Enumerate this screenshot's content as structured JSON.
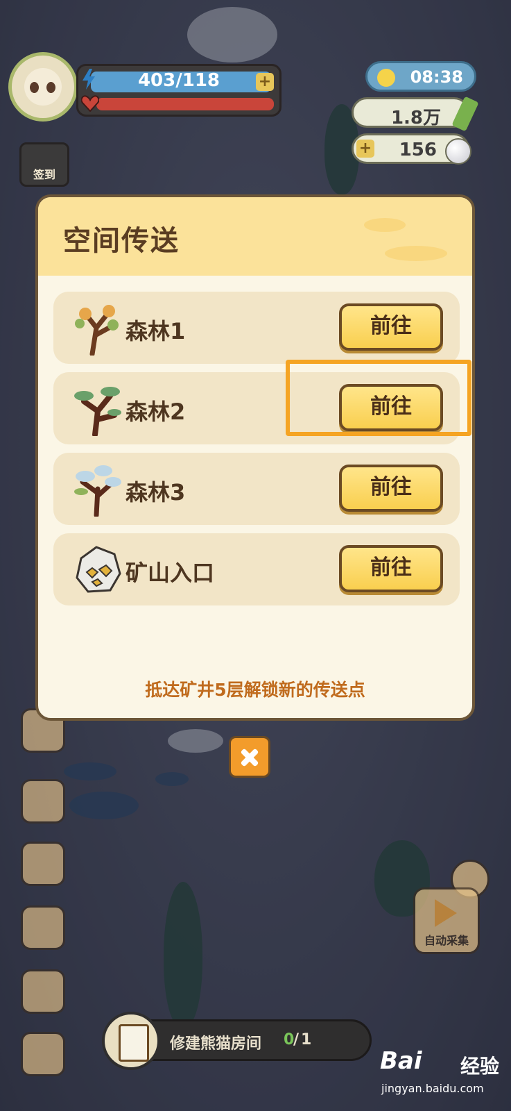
{
  "hud": {
    "energy": "403/118",
    "energy_plus": "+",
    "clock": "08:38",
    "currency_bamboo": "1.8万",
    "pearl_plus": "+",
    "pearls": "156",
    "signin_label": "签到"
  },
  "dialog": {
    "title": "空间传送",
    "destinations": [
      {
        "name": "森林1",
        "button": "前往",
        "icon": "forest-tree-icon"
      },
      {
        "name": "森林2",
        "button": "前往",
        "icon": "forest-tree-icon"
      },
      {
        "name": "森林3",
        "button": "前往",
        "icon": "mushroom-tree-icon"
      },
      {
        "name": "矿山入口",
        "button": "前往",
        "icon": "ore-rock-icon"
      }
    ],
    "hint": "抵达矿井5层解锁新的传送点",
    "highlighted_index": 1
  },
  "task": {
    "label": "修建熊猫房间",
    "done": "0",
    "sep": "/",
    "total": "1"
  },
  "auto_collect_label": "自动采集",
  "watermark": {
    "logo": "Bai",
    "word": "经验",
    "url": "jingyan.baidu.com"
  },
  "colors": {
    "accent_orange": "#f5a423",
    "button_yellow": "#f9cf4f",
    "dialog_bg": "#fbf6e6"
  }
}
